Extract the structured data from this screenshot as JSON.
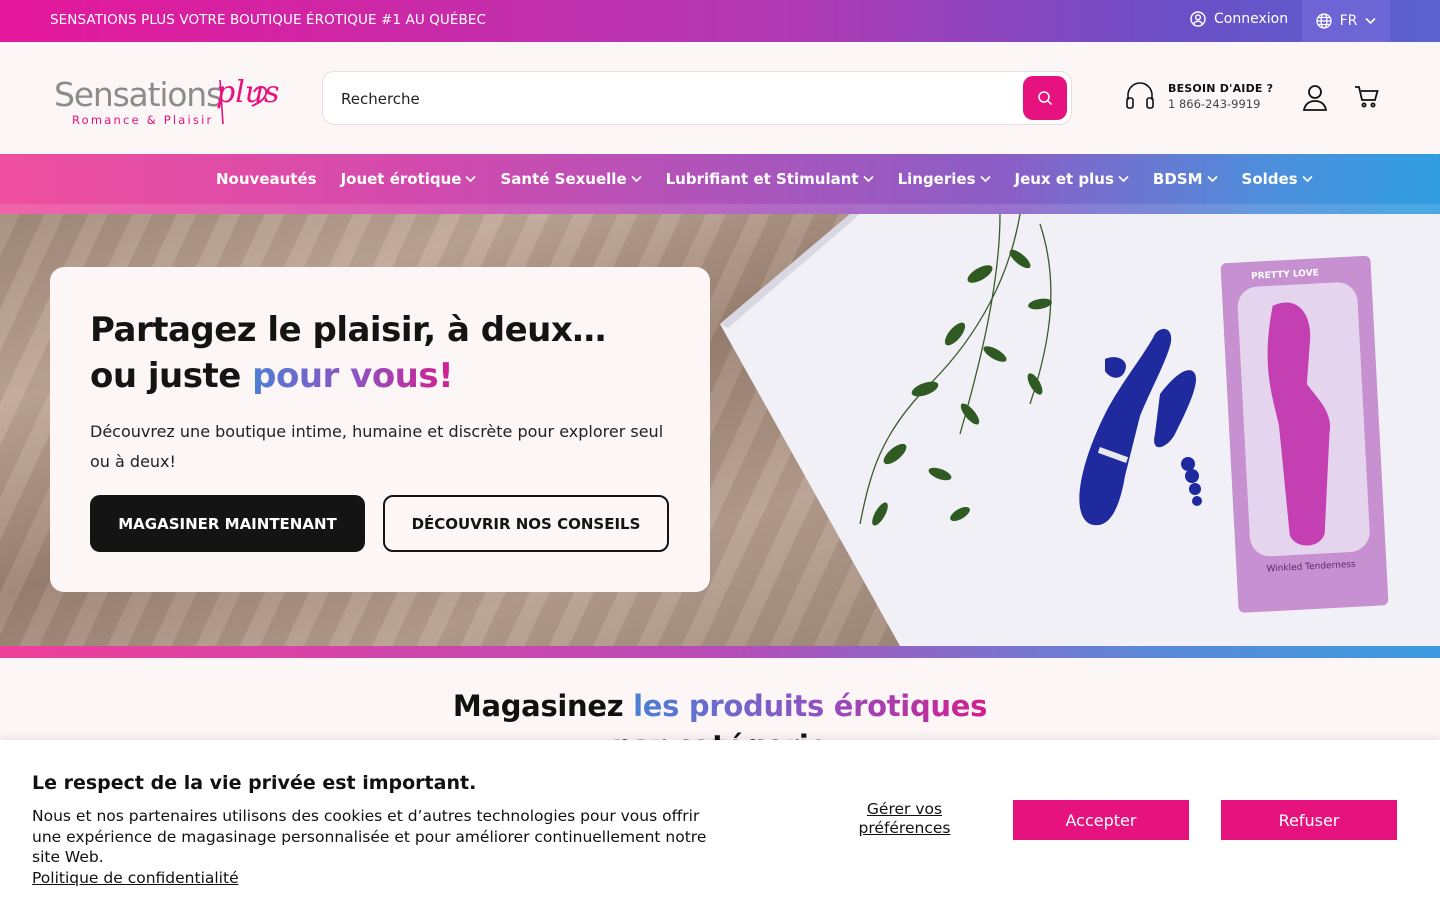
{
  "colors": {
    "accent": "#e5127f",
    "dark": "#141414",
    "grad_start": "#e5179a",
    "grad_end": "#2f9ee0"
  },
  "topbar": {
    "promo": "SENSATIONS PLUS VOTRE BOUTIQUE ÉROTIQUE #1 AU QUÉBEC",
    "login": "Connexion",
    "lang": "FR"
  },
  "header": {
    "logo_main": "Sensations",
    "logo_script": "plus",
    "logo_tagline": "Romance & Plaisir",
    "search_placeholder": "Recherche",
    "help_title": "BESOIN D'AIDE ?",
    "help_phone": "1 866-243-9919"
  },
  "nav": {
    "items": [
      {
        "label": "Nouveautés",
        "has_dropdown": false
      },
      {
        "label": "Jouet érotique",
        "has_dropdown": true
      },
      {
        "label": "Santé Sexuelle",
        "has_dropdown": true
      },
      {
        "label": "Lubrifiant et Stimulant",
        "has_dropdown": true
      },
      {
        "label": "Lingeries",
        "has_dropdown": true
      },
      {
        "label": "Jeux et plus",
        "has_dropdown": true
      },
      {
        "label": "BDSM",
        "has_dropdown": true
      },
      {
        "label": "Soldes",
        "has_dropdown": true
      }
    ]
  },
  "hero": {
    "title_part1": "Partagez le plaisir, à deux…ou juste ",
    "title_highlight": "pour vous!",
    "description": "Découvrez une boutique intime, humaine et discrète pour explorer seul ou à deux!",
    "primary_button": "MAGASINER MAINTENANT",
    "secondary_button": "DÉCOUVRIR NOS CONSEILS",
    "box_brand": "PRETTY LOVE",
    "box_product": "Winkled Tenderness"
  },
  "section": {
    "title_part1": "Magasinez ",
    "title_highlight": "les produits érotiques",
    "title_line2": "par catégorie"
  },
  "cookie": {
    "title": "Le respect de la vie privée est important.",
    "text": "Nous et nos partenaires utilisons des cookies et d’autres technologies pour vous offrir une expérience de magasinage personnalisée et pour améliorer continuellement notre site Web.",
    "policy_link": "Politique de confidentialité",
    "manage": "Gérer vos préférences",
    "accept": "Accepter",
    "refuse": "Refuser"
  }
}
